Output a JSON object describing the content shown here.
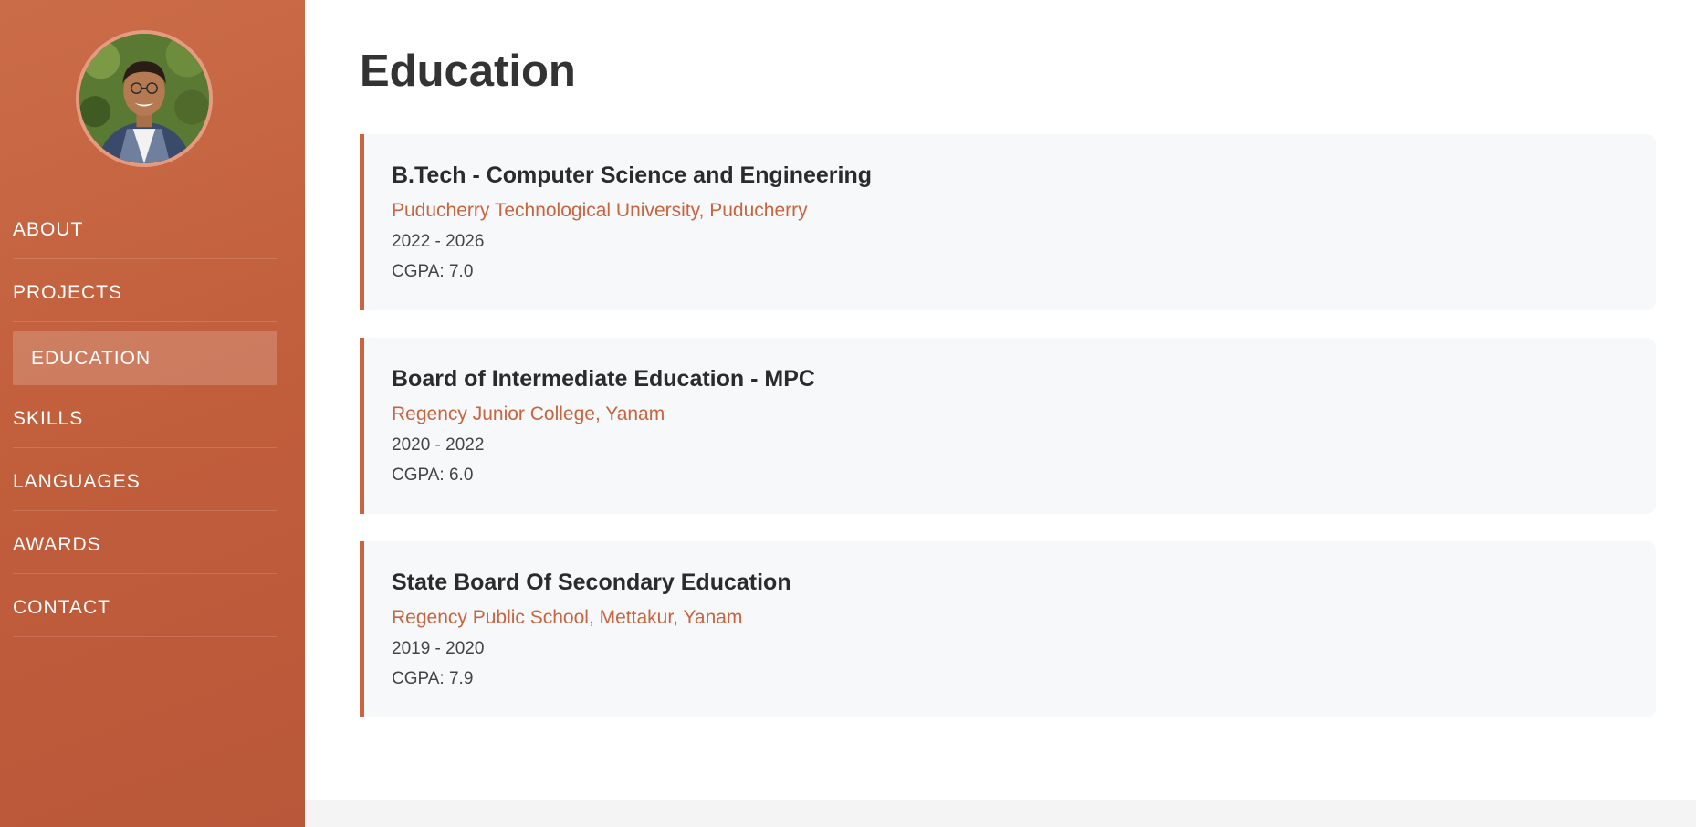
{
  "sidebar": {
    "avatar_alt": "profile photo",
    "items": [
      {
        "label": "ABOUT"
      },
      {
        "label": "PROJECTS"
      },
      {
        "label": "EDUCATION",
        "active": true
      },
      {
        "label": "SKILLS"
      },
      {
        "label": "LANGUAGES"
      },
      {
        "label": "AWARDS"
      },
      {
        "label": "CONTACT"
      }
    ]
  },
  "main": {
    "title": "Education",
    "entries": [
      {
        "degree": "B.Tech - Computer Science and Engineering",
        "school": "Puducherry Technological University, Puducherry",
        "years": "2022 - 2026",
        "grade": "CGPA: 7.0"
      },
      {
        "degree": "Board of Intermediate Education - MPC",
        "school": "Regency Junior College, Yanam",
        "years": "2020 - 2022",
        "grade": "CGPA: 6.0"
      },
      {
        "degree": "State Board Of Secondary Education",
        "school": "Regency Public School, Mettakur, Yanam",
        "years": "2019 - 2020",
        "grade": "CGPA: 7.9"
      }
    ]
  },
  "colors": {
    "accent": "#c8643f",
    "sidebar": "#c05d3b",
    "card_bg": "#f7f8fa"
  }
}
